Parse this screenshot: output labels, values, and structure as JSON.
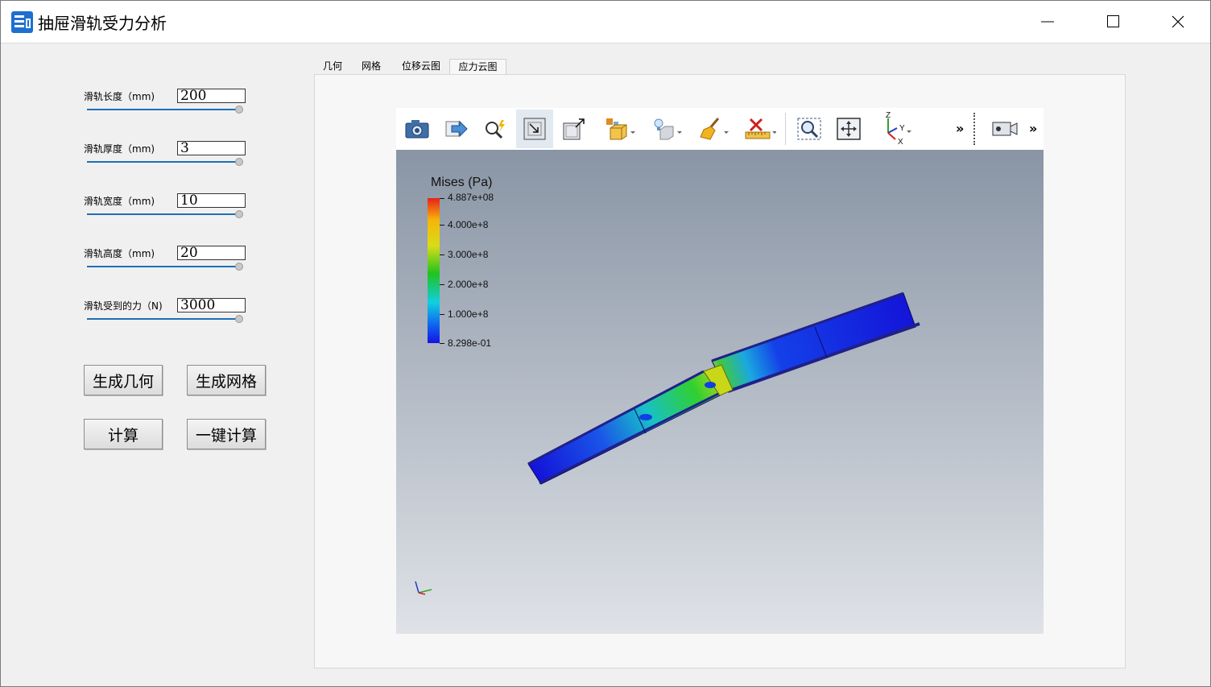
{
  "window": {
    "title": "抽屉滑轨受力分析",
    "icons": [
      "app-icon",
      "minimize-icon",
      "maximize-icon",
      "close-icon"
    ]
  },
  "params": [
    {
      "label": "滑轨长度（mm)",
      "value": "200",
      "slider_fraction": 1.0
    },
    {
      "label": "滑轨厚度（mm)",
      "value": "3",
      "slider_fraction": 1.0
    },
    {
      "label": "滑轨宽度（mm)",
      "value": "10",
      "slider_fraction": 1.0
    },
    {
      "label": "滑轨高度（mm)",
      "value": "20",
      "slider_fraction": 1.0
    },
    {
      "label": "滑轨受到的力（N)",
      "value": "3000",
      "slider_fraction": 1.0
    }
  ],
  "buttons": {
    "gen_geometry": "生成几何",
    "gen_mesh": "生成网格",
    "compute": "计算",
    "one_click": "一键计算"
  },
  "tabs": [
    "几何",
    "网格",
    "位移云图",
    "应力云图"
  ],
  "active_tab": "应力云图",
  "toolbar": {
    "icons": [
      "camera-icon",
      "export-icon",
      "interactive-select-icon",
      "select-cells-icon",
      "select-points-icon",
      "box-add-icon",
      "light-icon",
      "clear-brush-icon",
      "ruler-delete-icon",
      "zoom-to-box-icon",
      "reset-camera-icon",
      "axes-orientation-icon",
      "more-icon",
      "video-camera-icon",
      "more-icon-2"
    ],
    "more_glyph": "»"
  },
  "legend": {
    "title": "Mises (Pa)",
    "labels": [
      "4.887e+08",
      "4.000e+8",
      "3.000e+8",
      "2.000e+8",
      "1.000e+8",
      "8.298e-01"
    ],
    "colors": [
      "#e8201a",
      "#f7b40a",
      "#d8dd15",
      "#20c320",
      "#10cfe0",
      "#1060f0",
      "#1414e0"
    ]
  },
  "axes_labels": {
    "z": "Z",
    "y": "Y",
    "x": "X"
  }
}
